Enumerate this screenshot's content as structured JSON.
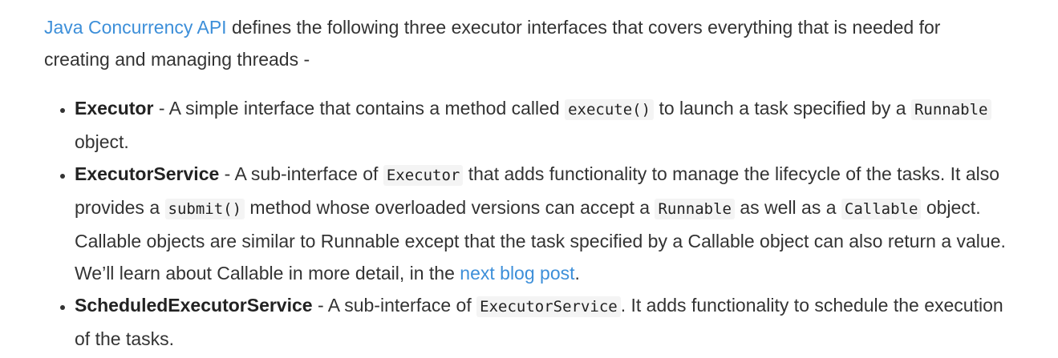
{
  "intro": {
    "link_text": "Java Concurrency API",
    "text": " defines the following three executor interfaces that covers everything that is needed for creating and managing threads -"
  },
  "items": [
    {
      "term": "Executor",
      "t1": " - A simple interface that contains a method called ",
      "c1": "execute()",
      "t2": " to launch a task specified by a ",
      "c2": "Runnable",
      "t3": " object."
    },
    {
      "term": "ExecutorService",
      "t1": " - A sub-interface of ",
      "c1": "Executor",
      "t2": " that adds functionality to manage the lifecycle of the tasks. It also provides a ",
      "c2": "submit()",
      "t3": " method whose overloaded versions can accept a ",
      "c3": "Runnable",
      "t4": " as well as a ",
      "c4": "Callable",
      "t5": " object. Callable objects are similar to Runnable except that the task specified by a Callable object can also return a value. We’ll learn about Callable in more detail, in the ",
      "link_text": "next blog post",
      "t6": "."
    },
    {
      "term": "ScheduledExecutorService",
      "t1": " - A sub-interface of ",
      "c1": "ExecutorService",
      "t2": ". It adds functionality to schedule the execution of the tasks."
    }
  ]
}
